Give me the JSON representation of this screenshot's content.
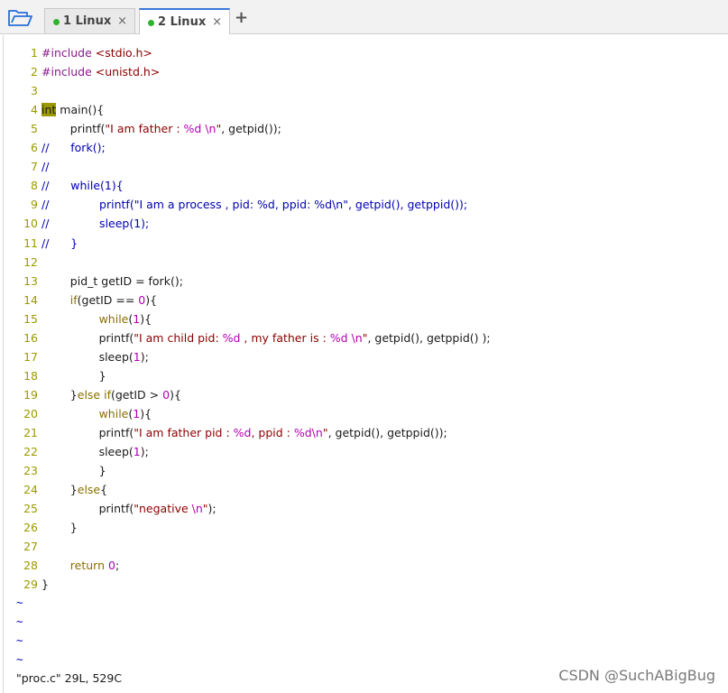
{
  "tabs": [
    {
      "label": "1 Linux",
      "active": false,
      "status_color": "#2fb32f"
    },
    {
      "label": "2 Linux",
      "active": true,
      "status_color": "#2fb32f"
    }
  ],
  "tab_close_glyph": "×",
  "tab_add_glyph": "+",
  "icons": {
    "open": "folder-open-icon",
    "close": "close-icon",
    "add": "plus-icon",
    "status": "connected-status-icon"
  },
  "editor": {
    "lines": [
      {
        "num": "1",
        "segs": [
          [
            "pre",
            "#include "
          ],
          [
            "inc",
            "<stdio.h>"
          ]
        ]
      },
      {
        "num": "2",
        "segs": [
          [
            "pre",
            "#include "
          ],
          [
            "inc",
            "<unistd.h>"
          ]
        ]
      },
      {
        "num": "3",
        "segs": []
      },
      {
        "num": "4",
        "segs": [
          [
            "type",
            "int"
          ],
          [
            "plain",
            " main(){"
          ]
        ]
      },
      {
        "num": "5",
        "segs": [
          [
            "plain",
            "        printf("
          ],
          [
            "str",
            "\"I am father : "
          ],
          [
            "fmt",
            "%d"
          ],
          [
            "str",
            " "
          ],
          [
            "fmt",
            "\\n"
          ],
          [
            "str",
            "\""
          ],
          [
            "plain",
            ", getpid());"
          ]
        ]
      },
      {
        "num": "6",
        "segs": [
          [
            "cmt",
            "//      fork();"
          ]
        ]
      },
      {
        "num": "7",
        "segs": [
          [
            "cmt",
            "//"
          ]
        ]
      },
      {
        "num": "8",
        "segs": [
          [
            "cmt",
            "//      while(1){"
          ]
        ]
      },
      {
        "num": "9",
        "segs": [
          [
            "cmt",
            "//              printf(\"I am a process , pid: %d, ppid: %d\\n\", getpid(), getppid());"
          ]
        ]
      },
      {
        "num": "10",
        "segs": [
          [
            "cmt",
            "//              sleep(1);"
          ]
        ]
      },
      {
        "num": "11",
        "segs": [
          [
            "cmt",
            "//      }"
          ]
        ]
      },
      {
        "num": "12",
        "segs": []
      },
      {
        "num": "13",
        "segs": [
          [
            "plain",
            "        pid_t getID = fork();"
          ]
        ]
      },
      {
        "num": "14",
        "segs": [
          [
            "plain",
            "        "
          ],
          [
            "kw",
            "if"
          ],
          [
            "plain",
            "(getID == "
          ],
          [
            "num",
            "0"
          ],
          [
            "plain",
            "){"
          ]
        ]
      },
      {
        "num": "15",
        "segs": [
          [
            "plain",
            "                "
          ],
          [
            "kw",
            "while"
          ],
          [
            "plain",
            "("
          ],
          [
            "num",
            "1"
          ],
          [
            "plain",
            "){"
          ]
        ]
      },
      {
        "num": "16",
        "segs": [
          [
            "plain",
            "                printf("
          ],
          [
            "str",
            "\"I am child pid: "
          ],
          [
            "fmt",
            "%d"
          ],
          [
            "str",
            " , my father is : "
          ],
          [
            "fmt",
            "%d"
          ],
          [
            "str",
            " "
          ],
          [
            "fmt",
            "\\n"
          ],
          [
            "str",
            "\""
          ],
          [
            "plain",
            ", getpid(), getppid() );"
          ]
        ]
      },
      {
        "num": "17",
        "segs": [
          [
            "plain",
            "                sleep("
          ],
          [
            "num",
            "1"
          ],
          [
            "plain",
            ");"
          ]
        ]
      },
      {
        "num": "18",
        "segs": [
          [
            "plain",
            "                }"
          ]
        ]
      },
      {
        "num": "19",
        "segs": [
          [
            "plain",
            "        }"
          ],
          [
            "kw",
            "else if"
          ],
          [
            "plain",
            "(getID > "
          ],
          [
            "num",
            "0"
          ],
          [
            "plain",
            "){"
          ]
        ]
      },
      {
        "num": "20",
        "segs": [
          [
            "plain",
            "                "
          ],
          [
            "kw",
            "while"
          ],
          [
            "plain",
            "("
          ],
          [
            "num",
            "1"
          ],
          [
            "plain",
            "){"
          ]
        ]
      },
      {
        "num": "21",
        "segs": [
          [
            "plain",
            "                printf("
          ],
          [
            "str",
            "\"I am father pid : "
          ],
          [
            "fmt",
            "%d"
          ],
          [
            "str",
            ", ppid : "
          ],
          [
            "fmt",
            "%d\\n"
          ],
          [
            "str",
            "\""
          ],
          [
            "plain",
            ", getpid(), getppid());"
          ]
        ]
      },
      {
        "num": "22",
        "segs": [
          [
            "plain",
            "                sleep("
          ],
          [
            "num",
            "1"
          ],
          [
            "plain",
            ");"
          ]
        ]
      },
      {
        "num": "23",
        "segs": [
          [
            "plain",
            "                }"
          ]
        ]
      },
      {
        "num": "24",
        "segs": [
          [
            "plain",
            "        }"
          ],
          [
            "kw",
            "else"
          ],
          [
            "plain",
            "{"
          ]
        ]
      },
      {
        "num": "25",
        "segs": [
          [
            "plain",
            "                printf("
          ],
          [
            "str",
            "\"negative "
          ],
          [
            "fmt",
            "\\n"
          ],
          [
            "str",
            "\""
          ],
          [
            "plain",
            ");"
          ]
        ]
      },
      {
        "num": "26",
        "segs": [
          [
            "plain",
            "        }"
          ]
        ]
      },
      {
        "num": "27",
        "segs": []
      },
      {
        "num": "28",
        "segs": [
          [
            "plain",
            "        "
          ],
          [
            "kw",
            "return"
          ],
          [
            "plain",
            " "
          ],
          [
            "num",
            "0"
          ],
          [
            "plain",
            ";"
          ]
        ]
      },
      {
        "num": "29",
        "segs": [
          [
            "plain",
            "}"
          ]
        ]
      }
    ],
    "tilde_lines": [
      "~",
      "~",
      "~",
      "~"
    ],
    "status_line": "\"proc.c\" 29L, 529C"
  },
  "watermark": "CSDN @SuchABigBug",
  "colors": {
    "line_number": "#9a9a00",
    "comment": "#0000b0",
    "string": "#8b0000",
    "format_specifier": "#b000b0",
    "keyword": "#8a6f00",
    "type_highlight": "#9a9a00",
    "active_tab_accent": "#3b78d8"
  }
}
